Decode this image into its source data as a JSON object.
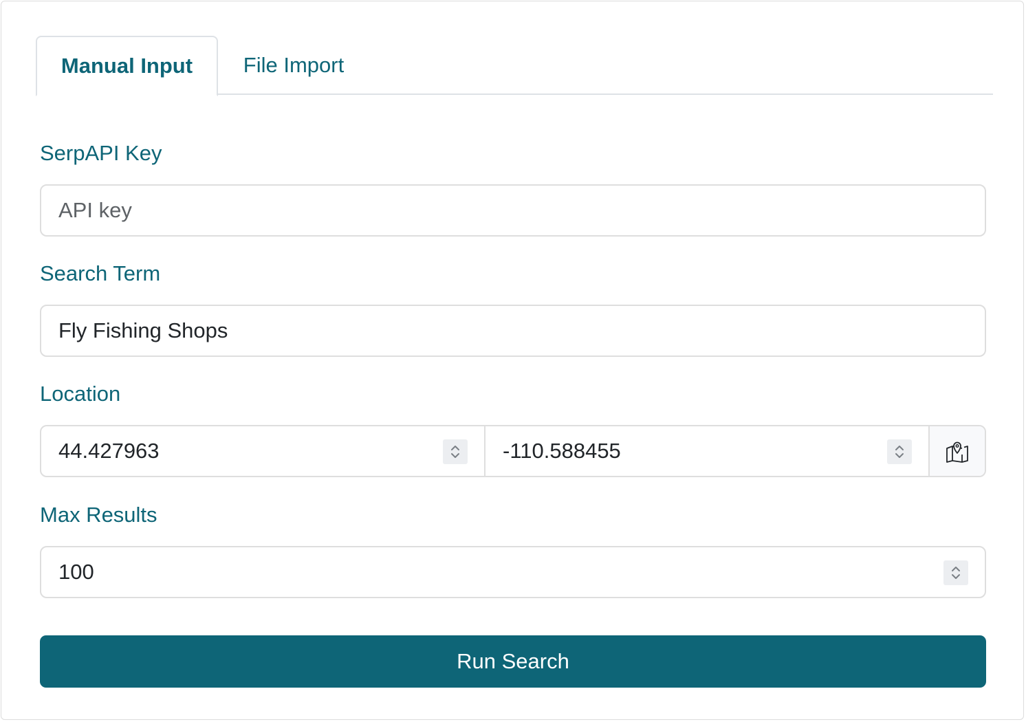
{
  "tabs": [
    {
      "label": "Manual Input",
      "active": true
    },
    {
      "label": "File Import",
      "active": false
    }
  ],
  "form": {
    "api_key": {
      "label": "SerpAPI Key",
      "placeholder": "API key",
      "value": ""
    },
    "search_term": {
      "label": "Search Term",
      "value": "Fly Fishing Shops"
    },
    "location": {
      "label": "Location",
      "latitude": "44.427963",
      "longitude": "-110.588455",
      "map_icon": "map-pin-icon"
    },
    "max_results": {
      "label": "Max Results",
      "value": "100"
    },
    "submit_label": "Run Search"
  },
  "colors": {
    "accent": "#0e6577",
    "border": "#dedede",
    "text": "#212529"
  }
}
